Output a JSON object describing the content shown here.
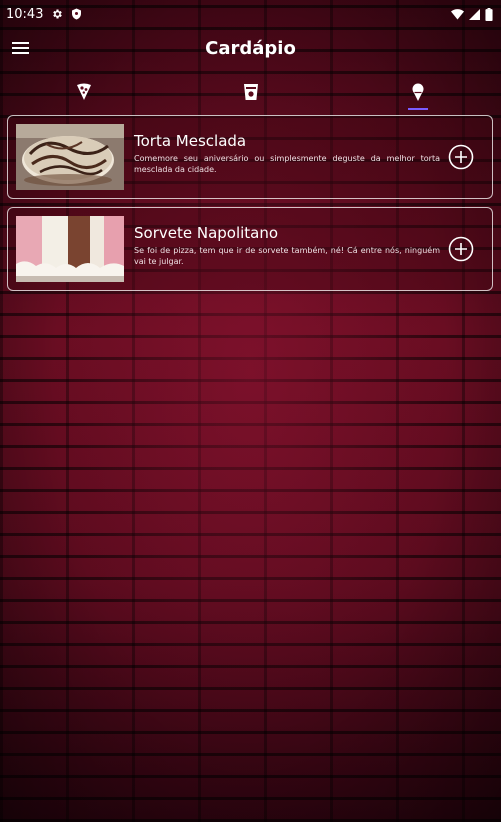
{
  "status_bar": {
    "time": "10:43",
    "left_icons": [
      "gear-icon",
      "shield-icon"
    ],
    "right_icons": [
      "wifi-icon",
      "signal-icon",
      "battery-icon"
    ]
  },
  "app_bar": {
    "title": "Cardápio",
    "menu_icon": "hamburger-menu-icon"
  },
  "tabs": [
    {
      "icon": "pizza-icon",
      "selected": false
    },
    {
      "icon": "drink-cup-icon",
      "selected": false
    },
    {
      "icon": "ice-cream-icon",
      "selected": true
    }
  ],
  "items": [
    {
      "name": "Torta Mesclada",
      "description": "Comemore seu aniversário ou simplesmente deguste da melhor torta mesclada da cidade.",
      "action_icon": "add-circle-icon"
    },
    {
      "name": "Sorvete Napolitano",
      "description": "Se foi de pizza, tem que ir de sorvete também, né! Cá entre nós, ninguém vai te julgar.",
      "action_icon": "add-circle-icon"
    }
  ],
  "colors": {
    "tab_indicator": "#7b5cff",
    "background": "#5a0a1c"
  }
}
